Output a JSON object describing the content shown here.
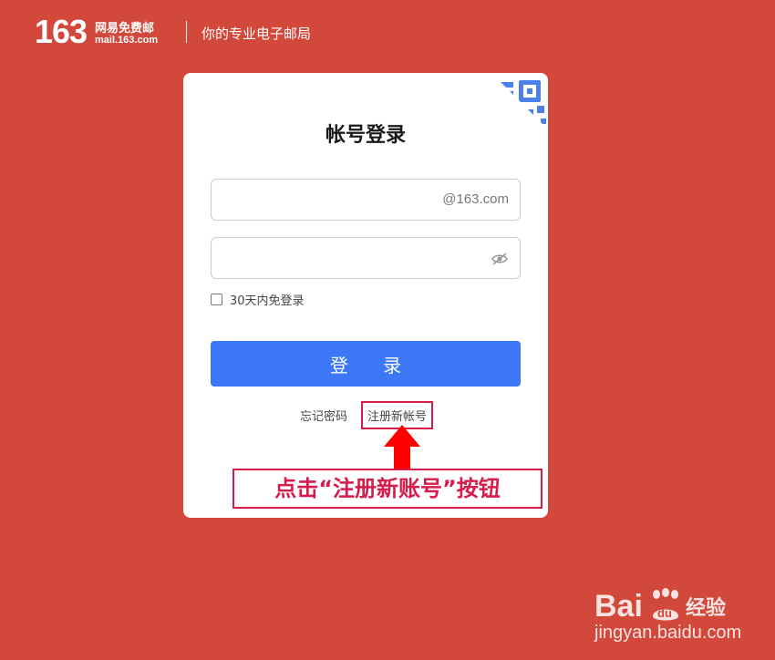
{
  "header": {
    "logo_number": "163",
    "logo_cn": "网易免费邮",
    "logo_en": "mail.163.com",
    "tagline": "你的专业电子邮局"
  },
  "login": {
    "title": "帐号登录",
    "username_suffix": "@163.com",
    "remember_label": "30天内免登录",
    "login_button": "登 录",
    "forgot_password": "忘记密码",
    "register": "注册新帐号"
  },
  "annotation": {
    "callout": "点击“注册新账号”按钮"
  },
  "watermark": {
    "url": "jingyan.baidu.com"
  },
  "colors": {
    "background": "#d2483b",
    "accent_button": "#3c78f5",
    "annotation": "#d71b4a"
  }
}
